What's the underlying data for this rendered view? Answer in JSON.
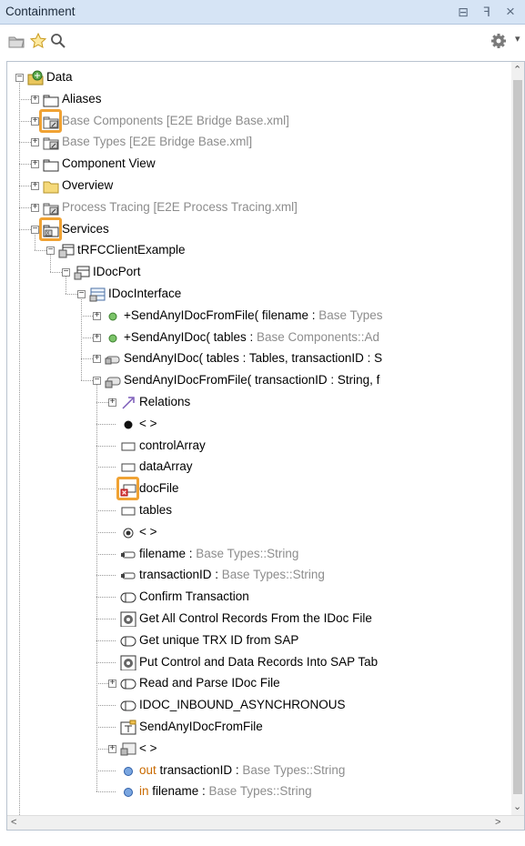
{
  "panel": {
    "title": "Containment",
    "restore_glyph": "⊟",
    "pin_glyph": "ꟻ",
    "close_glyph": "×"
  },
  "toolbar": {
    "icons": [
      "folder-open-icon",
      "star-icon",
      "search-icon",
      "gear-icon"
    ]
  },
  "tree": {
    "rows": [
      {
        "segments": [
          {
            "t": "Data",
            "c": ""
          }
        ]
      },
      {
        "segments": [
          {
            "t": "Aliases",
            "c": ""
          }
        ]
      },
      {
        "segments": [
          {
            "t": "Base Components [E2E Bridge Base.xml]",
            "c": "gray"
          }
        ]
      },
      {
        "segments": [
          {
            "t": "Base Types [E2E Bridge Base.xml]",
            "c": "gray"
          }
        ]
      },
      {
        "segments": [
          {
            "t": "Component View",
            "c": ""
          }
        ]
      },
      {
        "segments": [
          {
            "t": "Overview",
            "c": ""
          }
        ]
      },
      {
        "segments": [
          {
            "t": "Process Tracing [E2E Process Tracing.xml]",
            "c": "gray"
          }
        ]
      },
      {
        "segments": [
          {
            "t": "Services",
            "c": ""
          }
        ]
      },
      {
        "segments": [
          {
            "t": "tRFCClientExample",
            "c": ""
          }
        ]
      },
      {
        "segments": [
          {
            "t": "IDocPort",
            "c": ""
          }
        ]
      },
      {
        "segments": [
          {
            "t": "IDocInterface",
            "c": ""
          }
        ]
      },
      {
        "segments": [
          {
            "t": "+SendAnyIDocFromFile( filename : ",
            "c": ""
          },
          {
            "t": "Base Types",
            "c": "gray"
          }
        ]
      },
      {
        "segments": [
          {
            "t": "+SendAnyIDoc( tables : ",
            "c": ""
          },
          {
            "t": "Base Components::Ad",
            "c": "gray"
          }
        ]
      },
      {
        "segments": [
          {
            "t": "SendAnyIDoc( tables : Tables, transactionID : S",
            "c": ""
          }
        ]
      },
      {
        "segments": [
          {
            "t": "SendAnyIDocFromFile( transactionID : String, f",
            "c": ""
          }
        ]
      },
      {
        "segments": [
          {
            "t": "Relations",
            "c": ""
          }
        ]
      },
      {
        "segments": [
          {
            "t": "< >",
            "c": ""
          }
        ]
      },
      {
        "segments": [
          {
            "t": "controlArray",
            "c": ""
          }
        ]
      },
      {
        "segments": [
          {
            "t": "dataArray",
            "c": ""
          }
        ]
      },
      {
        "segments": [
          {
            "t": "docFile",
            "c": ""
          }
        ]
      },
      {
        "segments": [
          {
            "t": "tables",
            "c": ""
          }
        ]
      },
      {
        "segments": [
          {
            "t": "< >",
            "c": ""
          }
        ]
      },
      {
        "segments": [
          {
            "t": "filename : ",
            "c": ""
          },
          {
            "t": "Base Types::String",
            "c": "gray"
          }
        ]
      },
      {
        "segments": [
          {
            "t": "transactionID : ",
            "c": ""
          },
          {
            "t": "Base Types::String",
            "c": "gray"
          }
        ]
      },
      {
        "segments": [
          {
            "t": "Confirm Transaction",
            "c": ""
          }
        ]
      },
      {
        "segments": [
          {
            "t": "Get All Control Records From the IDoc File",
            "c": ""
          }
        ]
      },
      {
        "segments": [
          {
            "t": "Get unique TRX ID from SAP",
            "c": ""
          }
        ]
      },
      {
        "segments": [
          {
            "t": "Put Control and Data Records Into SAP Tab",
            "c": ""
          }
        ]
      },
      {
        "segments": [
          {
            "t": "Read and Parse IDoc File",
            "c": ""
          }
        ]
      },
      {
        "segments": [
          {
            "t": "IDOC_INBOUND_ASYNCHRONOUS",
            "c": ""
          }
        ]
      },
      {
        "segments": [
          {
            "t": "SendAnyIDocFromFile",
            "c": ""
          }
        ]
      },
      {
        "segments": [
          {
            "t": "< >",
            "c": ""
          }
        ]
      },
      {
        "segments": [
          {
            "t": "out",
            "c": "orange"
          },
          {
            "t": " transactionID : ",
            "c": ""
          },
          {
            "t": "Base Types::String",
            "c": "gray"
          }
        ]
      },
      {
        "segments": [
          {
            "t": "in",
            "c": "orange"
          },
          {
            "t": " filename : ",
            "c": ""
          },
          {
            "t": "Base Types::String",
            "c": "gray"
          }
        ]
      }
    ]
  },
  "colors": {
    "titlebar": "#d6e4f5",
    "highlight": "#f0a233",
    "folder": "#e8c45a"
  }
}
